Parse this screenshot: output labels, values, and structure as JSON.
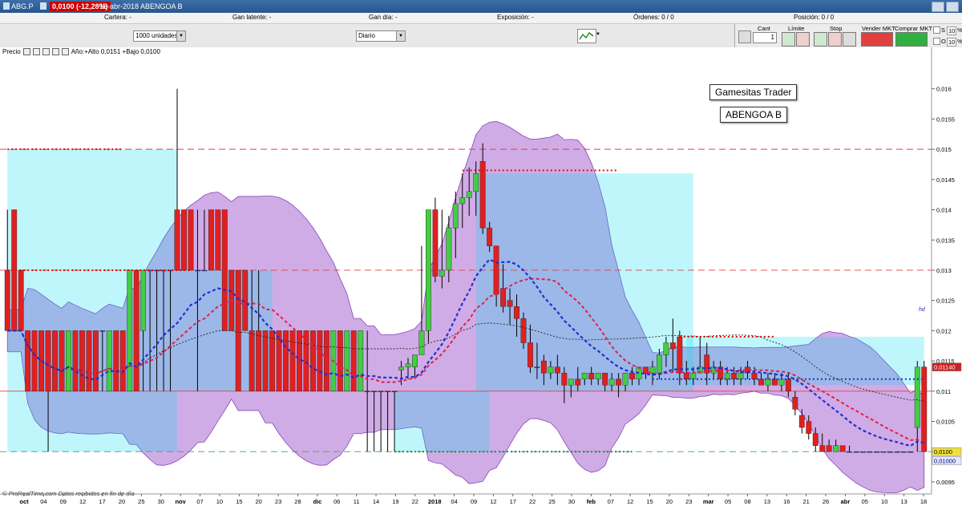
{
  "window": {
    "symbol": "ABG.P",
    "price_badge": "0,0100 (-12,28%)",
    "title": "18-abr-2018 ABENGOA B"
  },
  "infobar": {
    "cartera": "Cartera: -",
    "gan_latente": "Gan latente: -",
    "gan_dia": "Gan día: -",
    "exposicion": "Exposición: -",
    "ordenes": "Órdenes: 0 / 0",
    "posicion": "Posición: 0 / 0"
  },
  "controls": {
    "units": "1000 unidades",
    "period": "Diario"
  },
  "order_panel": {
    "cant_label": "Cant",
    "cant_value": "1",
    "limite_label": "Límite",
    "stop_label": "Stop",
    "sell_label": "Vender MKT",
    "buy_label": "Comprar MKT",
    "s_label": "S",
    "o_label": "O",
    "pct": "%",
    "val10": "10"
  },
  "chart_data": {
    "type": "candlestick",
    "legend_label": "Precio",
    "legend_text": "Año:+Alto 0,0151 +Bajo 0,0100",
    "annotations": [
      "Gamesitas Trader",
      "ABENGOA B"
    ],
    "hd_label": "hd",
    "source_note": "© ProRealTime.com  Datos recibidos en fin de día",
    "ylim": [
      0.0093,
      0.0165
    ],
    "y_ticks": [
      "0,016",
      "0,0155",
      "0,015",
      "0,0145",
      "0,014",
      "0,0135",
      "0,013",
      "0,0125",
      "0,012",
      "0,0115",
      "0,011",
      "0,0105",
      "0,01",
      "0,0095"
    ],
    "y_tick_values": [
      0.016,
      0.0155,
      0.015,
      0.0145,
      0.014,
      0.0135,
      0.013,
      0.0125,
      0.012,
      0.0115,
      0.011,
      0.0105,
      0.01,
      0.0095
    ],
    "price_labels": [
      {
        "text": "0,01140",
        "value": 0.0114,
        "color": "#ffffff",
        "bg": "#cc2222"
      },
      {
        "text": "0,0100",
        "value": 0.01,
        "color": "#000000",
        "bg": "#f0e040"
      },
      {
        "text": "0,01000",
        "value": 0.00985,
        "color": "#000080",
        "bg": "#e0e8ff"
      }
    ],
    "x_labels": [
      "oct",
      "04",
      "09",
      "12",
      "17",
      "20",
      "25",
      "30",
      "nov",
      "07",
      "10",
      "15",
      "20",
      "23",
      "28",
      "dic",
      "06",
      "11",
      "14",
      "19",
      "22",
      "2018",
      "04",
      "09",
      "12",
      "17",
      "22",
      "25",
      "30",
      "feb",
      "07",
      "12",
      "15",
      "20",
      "23",
      "mar",
      "05",
      "08",
      "13",
      "16",
      "21",
      "26",
      "abr",
      "05",
      "10",
      "13",
      "18"
    ],
    "x_label_bold": [
      "oct",
      "nov",
      "dic",
      "2018",
      "feb",
      "mar",
      "abr"
    ],
    "horizontal_levels": [
      {
        "value": 0.015,
        "style": "dashed",
        "color": "#e04040"
      },
      {
        "value": 0.013,
        "style": "dashed",
        "color": "#e04040"
      },
      {
        "value": 0.011,
        "style": "solid",
        "color": "#e04040"
      },
      {
        "value": 0.01,
        "style": "dashed",
        "color": "#40a060"
      }
    ],
    "candles": [
      {
        "o": 0.013,
        "h": 0.014,
        "l": 0.012,
        "c": 0.012
      },
      {
        "o": 0.014,
        "h": 0.014,
        "l": 0.012,
        "c": 0.012
      },
      {
        "o": 0.013,
        "h": 0.013,
        "l": 0.012,
        "c": 0.012
      },
      {
        "o": 0.012,
        "h": 0.012,
        "l": 0.011,
        "c": 0.011
      },
      {
        "o": 0.012,
        "h": 0.012,
        "l": 0.011,
        "c": 0.011
      },
      {
        "o": 0.012,
        "h": 0.012,
        "l": 0.011,
        "c": 0.011
      },
      {
        "o": 0.012,
        "h": 0.012,
        "l": 0.01,
        "c": 0.011
      },
      {
        "o": 0.012,
        "h": 0.012,
        "l": 0.011,
        "c": 0.011
      },
      {
        "o": 0.012,
        "h": 0.012,
        "l": 0.011,
        "c": 0.011
      },
      {
        "o": 0.011,
        "h": 0.012,
        "l": 0.011,
        "c": 0.012
      },
      {
        "o": 0.012,
        "h": 0.012,
        "l": 0.011,
        "c": 0.011
      },
      {
        "o": 0.012,
        "h": 0.012,
        "l": 0.011,
        "c": 0.011
      },
      {
        "o": 0.012,
        "h": 0.012,
        "l": 0.011,
        "c": 0.011
      },
      {
        "o": 0.012,
        "h": 0.012,
        "l": 0.011,
        "c": 0.011
      },
      {
        "o": 0.012,
        "h": 0.012,
        "l": 0.011,
        "c": 0.012
      },
      {
        "o": 0.011,
        "h": 0.012,
        "l": 0.011,
        "c": 0.012
      },
      {
        "o": 0.012,
        "h": 0.012,
        "l": 0.011,
        "c": 0.011
      },
      {
        "o": 0.012,
        "h": 0.012,
        "l": 0.011,
        "c": 0.011
      },
      {
        "o": 0.011,
        "h": 0.013,
        "l": 0.011,
        "c": 0.013
      },
      {
        "o": 0.013,
        "h": 0.013,
        "l": 0.011,
        "c": 0.011
      },
      {
        "o": 0.012,
        "h": 0.013,
        "l": 0.011,
        "c": 0.013
      },
      {
        "o": 0.013,
        "h": 0.013,
        "l": 0.011,
        "c": 0.013
      },
      {
        "o": 0.013,
        "h": 0.013,
        "l": 0.011,
        "c": 0.013
      },
      {
        "o": 0.013,
        "h": 0.013,
        "l": 0.011,
        "c": 0.013
      },
      {
        "o": 0.013,
        "h": 0.013,
        "l": 0.011,
        "c": 0.013
      },
      {
        "o": 0.014,
        "h": 0.016,
        "l": 0.013,
        "c": 0.013
      },
      {
        "o": 0.014,
        "h": 0.014,
        "l": 0.013,
        "c": 0.013
      },
      {
        "o": 0.014,
        "h": 0.014,
        "l": 0.013,
        "c": 0.013
      },
      {
        "o": 0.013,
        "h": 0.014,
        "l": 0.011,
        "c": 0.013
      },
      {
        "o": 0.013,
        "h": 0.014,
        "l": 0.013,
        "c": 0.013
      },
      {
        "o": 0.014,
        "h": 0.014,
        "l": 0.013,
        "c": 0.013
      },
      {
        "o": 0.014,
        "h": 0.014,
        "l": 0.013,
        "c": 0.013
      },
      {
        "o": 0.014,
        "h": 0.014,
        "l": 0.012,
        "c": 0.012
      },
      {
        "o": 0.013,
        "h": 0.013,
        "l": 0.012,
        "c": 0.012
      },
      {
        "o": 0.013,
        "h": 0.013,
        "l": 0.011,
        "c": 0.011
      },
      {
        "o": 0.013,
        "h": 0.013,
        "l": 0.012,
        "c": 0.012
      },
      {
        "o": 0.012,
        "h": 0.013,
        "l": 0.011,
        "c": 0.011
      },
      {
        "o": 0.012,
        "h": 0.013,
        "l": 0.011,
        "c": 0.011
      },
      {
        "o": 0.012,
        "h": 0.012,
        "l": 0.011,
        "c": 0.011
      },
      {
        "o": 0.012,
        "h": 0.012,
        "l": 0.011,
        "c": 0.011
      },
      {
        "o": 0.012,
        "h": 0.012,
        "l": 0.011,
        "c": 0.011
      },
      {
        "o": 0.012,
        "h": 0.012,
        "l": 0.011,
        "c": 0.011
      },
      {
        "o": 0.012,
        "h": 0.012,
        "l": 0.011,
        "c": 0.011
      },
      {
        "o": 0.012,
        "h": 0.012,
        "l": 0.011,
        "c": 0.011
      },
      {
        "o": 0.012,
        "h": 0.012,
        "l": 0.011,
        "c": 0.011
      },
      {
        "o": 0.012,
        "h": 0.012,
        "l": 0.011,
        "c": 0.011
      },
      {
        "o": 0.012,
        "h": 0.012,
        "l": 0.011,
        "c": 0.011
      },
      {
        "o": 0.012,
        "h": 0.012,
        "l": 0.011,
        "c": 0.011
      },
      {
        "o": 0.011,
        "h": 0.012,
        "l": 0.011,
        "c": 0.012
      },
      {
        "o": 0.012,
        "h": 0.012,
        "l": 0.011,
        "c": 0.011
      },
      {
        "o": 0.011,
        "h": 0.012,
        "l": 0.011,
        "c": 0.012
      },
      {
        "o": 0.012,
        "h": 0.012,
        "l": 0.011,
        "c": 0.011
      },
      {
        "o": 0.011,
        "h": 0.012,
        "l": 0.011,
        "c": 0.012
      },
      {
        "o": 0.011,
        "h": 0.012,
        "l": 0.01,
        "c": 0.011
      },
      {
        "o": 0.011,
        "h": 0.011,
        "l": 0.01,
        "c": 0.011
      },
      {
        "o": 0.011,
        "h": 0.011,
        "l": 0.01,
        "c": 0.011
      },
      {
        "o": 0.011,
        "h": 0.011,
        "l": 0.01,
        "c": 0.011
      },
      {
        "o": 0.011,
        "h": 0.011,
        "l": 0.01,
        "c": 0.011
      },
      {
        "o": 0.01135,
        "h": 0.0115,
        "l": 0.0111,
        "c": 0.0114
      },
      {
        "o": 0.0114,
        "h": 0.01155,
        "l": 0.0112,
        "c": 0.01145
      },
      {
        "o": 0.0114,
        "h": 0.0116,
        "l": 0.0112,
        "c": 0.0116
      },
      {
        "o": 0.0116,
        "h": 0.0134,
        "l": 0.0116,
        "c": 0.012
      },
      {
        "o": 0.012,
        "h": 0.014,
        "l": 0.0118,
        "c": 0.014
      },
      {
        "o": 0.014,
        "h": 0.0142,
        "l": 0.0128,
        "c": 0.0129
      },
      {
        "o": 0.0129,
        "h": 0.014,
        "l": 0.0127,
        "c": 0.013
      },
      {
        "o": 0.013,
        "h": 0.0139,
        "l": 0.0128,
        "c": 0.0137
      },
      {
        "o": 0.0137,
        "h": 0.0143,
        "l": 0.0132,
        "c": 0.0141
      },
      {
        "o": 0.0141,
        "h": 0.0146,
        "l": 0.0137,
        "c": 0.0142
      },
      {
        "o": 0.0142,
        "h": 0.0147,
        "l": 0.0139,
        "c": 0.0143
      },
      {
        "o": 0.0143,
        "h": 0.0148,
        "l": 0.0139,
        "c": 0.0146
      },
      {
        "o": 0.0148,
        "h": 0.0151,
        "l": 0.0136,
        "c": 0.0137
      },
      {
        "o": 0.0137,
        "h": 0.0138,
        "l": 0.0133,
        "c": 0.0134
      },
      {
        "o": 0.0134,
        "h": 0.0134,
        "l": 0.0124,
        "c": 0.0126
      },
      {
        "o": 0.0127,
        "h": 0.0131,
        "l": 0.0123,
        "c": 0.0124
      },
      {
        "o": 0.0125,
        "h": 0.0127,
        "l": 0.0121,
        "c": 0.0124
      },
      {
        "o": 0.0124,
        "h": 0.0126,
        "l": 0.0119,
        "c": 0.0122
      },
      {
        "o": 0.0122,
        "h": 0.0123,
        "l": 0.0117,
        "c": 0.0118
      },
      {
        "o": 0.0118,
        "h": 0.0121,
        "l": 0.0113,
        "c": 0.0114
      },
      {
        "o": 0.0114,
        "h": 0.0118,
        "l": 0.0112,
        "c": 0.0114
      },
      {
        "o": 0.0115,
        "h": 0.0116,
        "l": 0.0111,
        "c": 0.0113
      },
      {
        "o": 0.0113,
        "h": 0.0115,
        "l": 0.0112,
        "c": 0.0114
      },
      {
        "o": 0.0114,
        "h": 0.0116,
        "l": 0.0111,
        "c": 0.0113
      },
      {
        "o": 0.0113,
        "h": 0.0114,
        "l": 0.0108,
        "c": 0.0111
      },
      {
        "o": 0.0111,
        "h": 0.0112,
        "l": 0.0109,
        "c": 0.0112
      },
      {
        "o": 0.0112,
        "h": 0.0114,
        "l": 0.011,
        "c": 0.0111
      },
      {
        "o": 0.0112,
        "h": 0.0113,
        "l": 0.0111,
        "c": 0.0113
      },
      {
        "o": 0.0113,
        "h": 0.0114,
        "l": 0.0111,
        "c": 0.0112
      },
      {
        "o": 0.0112,
        "h": 0.0113,
        "l": 0.0111,
        "c": 0.0113
      },
      {
        "o": 0.0113,
        "h": 0.0113,
        "l": 0.011,
        "c": 0.0111
      },
      {
        "o": 0.0111,
        "h": 0.0113,
        "l": 0.011,
        "c": 0.0112
      },
      {
        "o": 0.0112,
        "h": 0.0113,
        "l": 0.0109,
        "c": 0.0111
      },
      {
        "o": 0.0111,
        "h": 0.0113,
        "l": 0.011,
        "c": 0.0113
      },
      {
        "o": 0.0113,
        "h": 0.0114,
        "l": 0.0111,
        "c": 0.0112
      },
      {
        "o": 0.0112,
        "h": 0.0114,
        "l": 0.0111,
        "c": 0.0114
      },
      {
        "o": 0.0114,
        "h": 0.0114,
        "l": 0.0112,
        "c": 0.0113
      },
      {
        "o": 0.0113,
        "h": 0.0115,
        "l": 0.0111,
        "c": 0.0114
      },
      {
        "o": 0.0113,
        "h": 0.0117,
        "l": 0.0112,
        "c": 0.0116
      },
      {
        "o": 0.0116,
        "h": 0.0119,
        "l": 0.0114,
        "c": 0.0118
      },
      {
        "o": 0.0118,
        "h": 0.0122,
        "l": 0.0113,
        "c": 0.0117
      },
      {
        "o": 0.0119,
        "h": 0.012,
        "l": 0.0111,
        "c": 0.0113
      },
      {
        "o": 0.0113,
        "h": 0.0115,
        "l": 0.0111,
        "c": 0.0112
      },
      {
        "o": 0.0112,
        "h": 0.0114,
        "l": 0.0111,
        "c": 0.0113
      },
      {
        "o": 0.0113,
        "h": 0.0119,
        "l": 0.0113,
        "c": 0.0114
      },
      {
        "o": 0.0116,
        "h": 0.0118,
        "l": 0.0111,
        "c": 0.0113
      },
      {
        "o": 0.0113,
        "h": 0.0115,
        "l": 0.0112,
        "c": 0.0114
      },
      {
        "o": 0.0114,
        "h": 0.0115,
        "l": 0.0111,
        "c": 0.0112
      },
      {
        "o": 0.0112,
        "h": 0.0114,
        "l": 0.0111,
        "c": 0.0113
      },
      {
        "o": 0.0113,
        "h": 0.0114,
        "l": 0.0111,
        "c": 0.0112
      },
      {
        "o": 0.0112,
        "h": 0.0114,
        "l": 0.0111,
        "c": 0.0113
      },
      {
        "o": 0.0114,
        "h": 0.0115,
        "l": 0.0112,
        "c": 0.0113
      },
      {
        "o": 0.0113,
        "h": 0.0114,
        "l": 0.0111,
        "c": 0.0112
      },
      {
        "o": 0.0112,
        "h": 0.0113,
        "l": 0.0111,
        "c": 0.0111
      },
      {
        "o": 0.0111,
        "h": 0.0113,
        "l": 0.011,
        "c": 0.0112
      },
      {
        "o": 0.0112,
        "h": 0.0113,
        "l": 0.0111,
        "c": 0.0111
      },
      {
        "o": 0.0111,
        "h": 0.0113,
        "l": 0.011,
        "c": 0.0112
      },
      {
        "o": 0.0112,
        "h": 0.0113,
        "l": 0.0109,
        "c": 0.011
      },
      {
        "o": 0.0109,
        "h": 0.011,
        "l": 0.0106,
        "c": 0.0107
      },
      {
        "o": 0.0106,
        "h": 0.0107,
        "l": 0.0103,
        "c": 0.0104
      },
      {
        "o": 0.0105,
        "h": 0.0106,
        "l": 0.0102,
        "c": 0.0103
      },
      {
        "o": 0.0103,
        "h": 0.0104,
        "l": 0.01,
        "c": 0.0101
      },
      {
        "o": 0.0101,
        "h": 0.0103,
        "l": 0.01,
        "c": 0.01
      },
      {
        "o": 0.0101,
        "h": 0.0102,
        "l": 0.01,
        "c": 0.01
      },
      {
        "o": 0.01,
        "h": 0.0102,
        "l": 0.01,
        "c": 0.0101
      },
      {
        "o": 0.0101,
        "h": 0.0101,
        "l": 0.01,
        "c": 0.01
      },
      {
        "o": 0.01,
        "h": 0.0101,
        "l": 0.01,
        "c": 0.01
      },
      {
        "o": 0.01,
        "h": 0.01,
        "l": 0.01,
        "c": 0.01
      },
      {
        "o": 0.01,
        "h": 0.01,
        "l": 0.01,
        "c": 0.01
      },
      {
        "o": 0.01,
        "h": 0.01,
        "l": 0.01,
        "c": 0.01
      },
      {
        "o": 0.01,
        "h": 0.01,
        "l": 0.01,
        "c": 0.01
      },
      {
        "o": 0.01,
        "h": 0.01,
        "l": 0.01,
        "c": 0.01
      },
      {
        "o": 0.01,
        "h": 0.01,
        "l": 0.01,
        "c": 0.01
      },
      {
        "o": 0.01,
        "h": 0.01,
        "l": 0.01,
        "c": 0.01
      },
      {
        "o": 0.01,
        "h": 0.01,
        "l": 0.01,
        "c": 0.01
      },
      {
        "o": 0.01,
        "h": 0.01,
        "l": 0.01,
        "c": 0.01
      },
      {
        "o": 0.0104,
        "h": 0.0115,
        "l": 0.01,
        "c": 0.0114
      },
      {
        "o": 0.0114,
        "h": 0.0115,
        "l": 0.01,
        "c": 0.01
      }
    ]
  }
}
